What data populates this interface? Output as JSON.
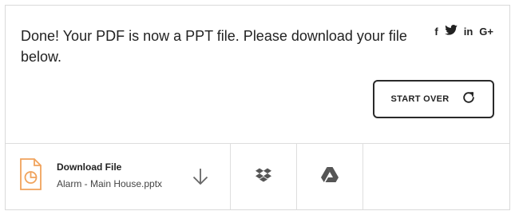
{
  "message": "Done! Your PDF is now a PPT file. Please download your file below.",
  "social": {
    "facebook": "f",
    "twitter_icon": "twitter-icon",
    "linkedin": "in",
    "googleplus": "G+"
  },
  "start_over": {
    "label": "START OVER",
    "icon": "refresh-icon"
  },
  "file": {
    "title": "Download File",
    "name": "Alarm - Main House.pptx",
    "icon": "pptx-file-icon",
    "accent": "#f0a35c"
  },
  "actions": {
    "download_icon": "download-arrow-icon",
    "dropbox_icon": "dropbox-icon",
    "gdrive_icon": "google-drive-icon"
  }
}
